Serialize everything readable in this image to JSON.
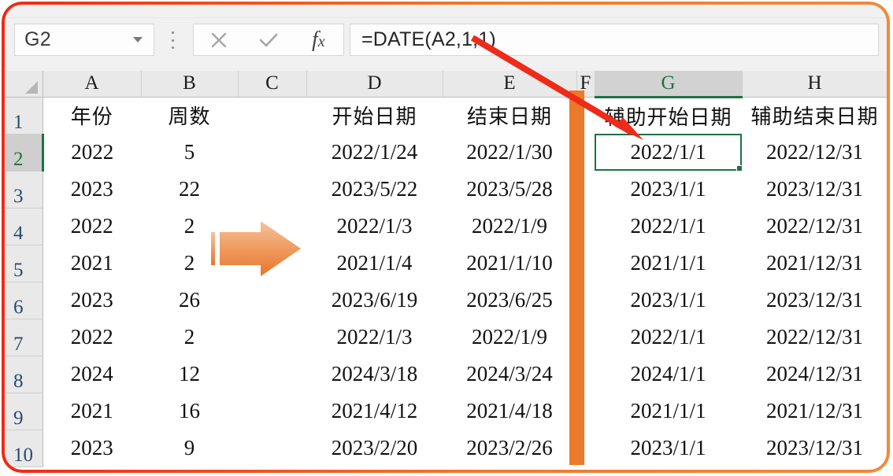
{
  "app": {
    "name_box_value": "G2",
    "formula_bar_value": "=DATE(A2,1,1)",
    "formula_bar_placeholder": "",
    "cancel_icon": "close-icon",
    "enter_icon": "check-icon",
    "insert_function_icon": "fx-icon",
    "name_box_dropdown_icon": "chevron-down-icon",
    "more_options_icon": "kebab-menu-icon",
    "select_all_icon": "select-all-triangle-icon"
  },
  "grid": {
    "column_headers": [
      "A",
      "B",
      "C",
      "D",
      "E",
      "F",
      "G",
      "H"
    ],
    "active_column": "G",
    "active_row": "2",
    "selected_cell": "G2",
    "row_headers": [
      "1",
      "2",
      "3",
      "4",
      "5",
      "6",
      "7",
      "8",
      "9",
      "10"
    ],
    "header_row": {
      "A": "年份",
      "B": "周数",
      "C": "",
      "D": "开始日期",
      "E": "结束日期",
      "F": "",
      "G": "辅助开始日期",
      "H": "辅助结束日期"
    },
    "rows": [
      {
        "r": "2",
        "A": "2022",
        "B": "5",
        "C": "",
        "D": "2022/1/24",
        "E": "2022/1/30",
        "F": "",
        "G": "2022/1/1",
        "H": "2022/12/31"
      },
      {
        "r": "3",
        "A": "2023",
        "B": "22",
        "C": "",
        "D": "2023/5/22",
        "E": "2023/5/28",
        "F": "",
        "G": "2023/1/1",
        "H": "2023/12/31"
      },
      {
        "r": "4",
        "A": "2022",
        "B": "2",
        "C": "",
        "D": "2022/1/3",
        "E": "2022/1/9",
        "F": "",
        "G": "2022/1/1",
        "H": "2022/12/31"
      },
      {
        "r": "5",
        "A": "2021",
        "B": "2",
        "C": "",
        "D": "2021/1/4",
        "E": "2021/1/10",
        "F": "",
        "G": "2021/1/1",
        "H": "2021/12/31"
      },
      {
        "r": "6",
        "A": "2023",
        "B": "26",
        "C": "",
        "D": "2023/6/19",
        "E": "2023/6/25",
        "F": "",
        "G": "2023/1/1",
        "H": "2023/12/31"
      },
      {
        "r": "7",
        "A": "2022",
        "B": "2",
        "C": "",
        "D": "2022/1/3",
        "E": "2022/1/9",
        "F": "",
        "G": "2022/1/1",
        "H": "2022/12/31"
      },
      {
        "r": "8",
        "A": "2024",
        "B": "12",
        "C": "",
        "D": "2024/3/18",
        "E": "2024/3/24",
        "F": "",
        "G": "2024/1/1",
        "H": "2024/12/31"
      },
      {
        "r": "9",
        "A": "2021",
        "B": "16",
        "C": "",
        "D": "2021/4/12",
        "E": "2021/4/18",
        "F": "",
        "G": "2021/1/1",
        "H": "2021/12/31"
      },
      {
        "r": "10",
        "A": "2023",
        "B": "9",
        "C": "",
        "D": "2023/2/20",
        "E": "2023/2/26",
        "F": "",
        "G": "2023/1/1",
        "H": "2023/12/31"
      }
    ]
  },
  "annotations": {
    "orange_arrow_icon": "right-block-arrow-icon",
    "orange_divider_icon": "vertical-divider-bar",
    "red_pointer_icon": "red-pointer-arrow-icon"
  },
  "colors": {
    "accent_orange": "#ea7a29",
    "accent_red": "#ee2b19",
    "selection_green": "#1e7145",
    "header_gray": "#e9e9e9",
    "active_header_gray": "#d2d2d2"
  }
}
